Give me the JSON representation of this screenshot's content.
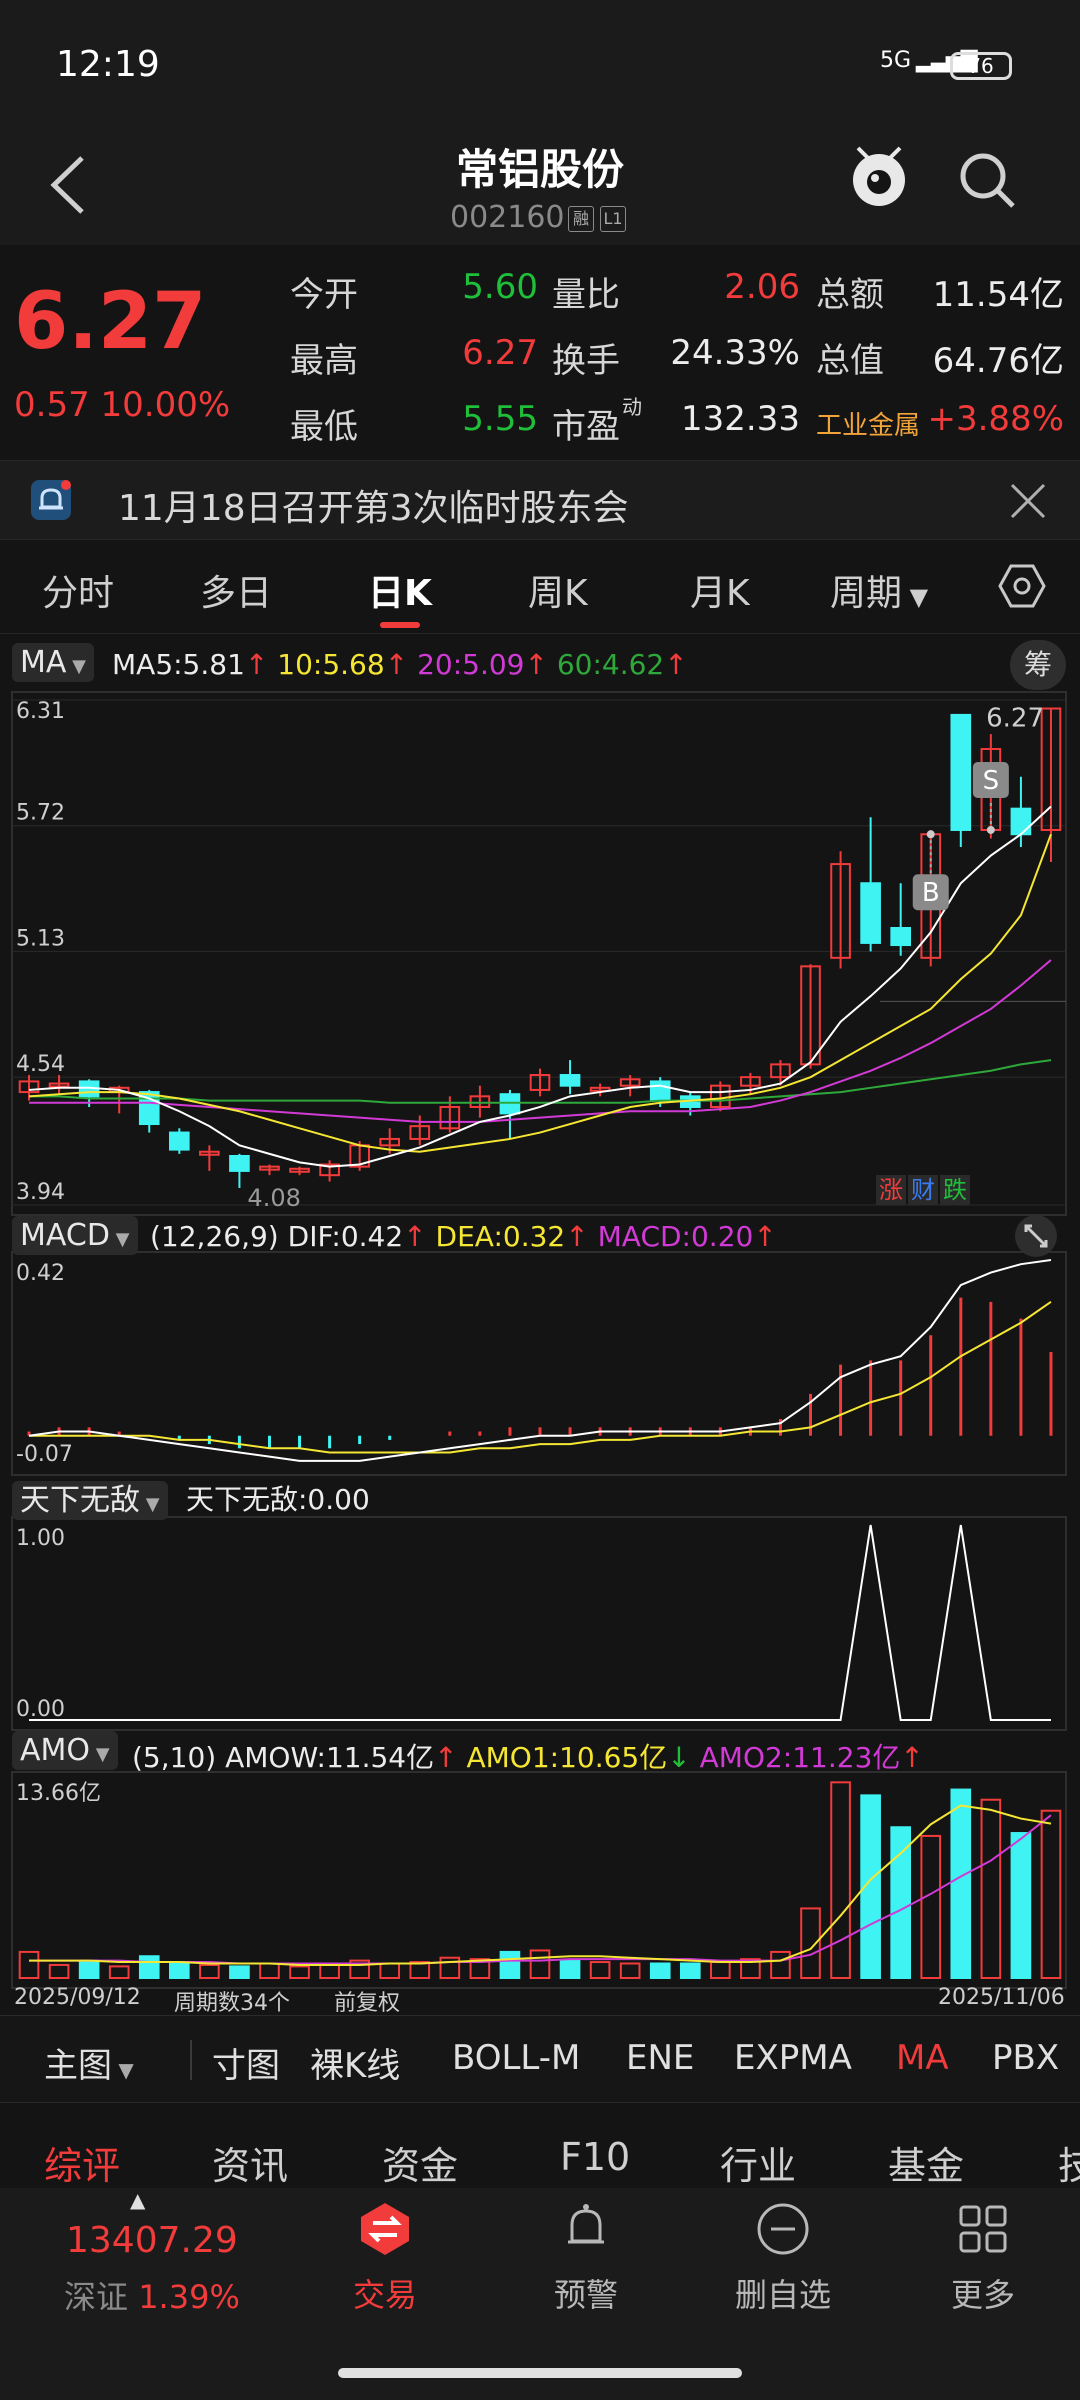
{
  "status_bar": {
    "time": "12:19",
    "signal": "5G",
    "battery": "76"
  },
  "header": {
    "title": "常铝股份",
    "code": "002160",
    "tag1": "融",
    "tag2": "L1"
  },
  "quote": {
    "price": "6.27",
    "change": "0.57",
    "change_pct": "10.00%",
    "rows": [
      {
        "l1": "今开",
        "v1": "5.60",
        "c1": "green",
        "l2": "量比",
        "v2": "2.06",
        "c2": "red",
        "l3": "总额",
        "v3": "11.54亿",
        "c3": "white"
      },
      {
        "l1": "最高",
        "v1": "6.27",
        "c1": "red",
        "l2": "换手",
        "v2": "24.33%",
        "c2": "white",
        "l3": "总值",
        "v3": "64.76亿",
        "c3": "white"
      },
      {
        "l1": "最低",
        "v1": "5.55",
        "c1": "green",
        "l2": "市盈",
        "v2": "132.33",
        "c2": "white",
        "l3": "工业金属",
        "v3": "+3.88%",
        "c3": "red"
      }
    ],
    "pe_sup": "动"
  },
  "notice": {
    "text": "11月18日召开第3次临时股东会"
  },
  "tabs": [
    "分时",
    "多日",
    "日K",
    "周K",
    "月K",
    "周期"
  ],
  "main_chart": {
    "indicator": "MA",
    "ma5": "MA5:5.81",
    "ma10": "10:5.68",
    "ma20": "20:5.09",
    "ma60": "60:4.62",
    "chip_btn": "筹",
    "y_ticks": [
      "6.31",
      "5.72",
      "5.13",
      "4.54",
      "3.94"
    ],
    "high_label": "6.27",
    "low_label": "4.08",
    "b_marker": "B",
    "s_marker": "S",
    "zdf": [
      "涨",
      "财",
      "跌"
    ]
  },
  "macd": {
    "name": "MACD",
    "params": "(12,26,9)",
    "dif": "DIF:0.42",
    "dea": "DEA:0.32",
    "macd": "MACD:0.20",
    "top": "0.42",
    "bottom": "-0.07"
  },
  "txwd": {
    "name": "天下无敌",
    "value": "天下无敌:0.00",
    "top": "1.00",
    "bottom": "0.00"
  },
  "amo": {
    "name": "AMO",
    "params": "(5,10)",
    "amow": "AMOW:11.54亿",
    "amo1": "AMO1:10.65亿",
    "amo2": "AMO2:11.23亿",
    "top": "13.66亿",
    "date_start": "2025/09/12",
    "period": "周期数34个",
    "adjust": "前复权",
    "date_end": "2025/11/06"
  },
  "indicator_bar": [
    "主图",
    "寸图",
    "裸K线",
    "BOLL-M",
    "ENE",
    "EXPMA",
    "MA",
    "PBX"
  ],
  "sections": [
    "综评",
    "资讯",
    "资金",
    "F10",
    "行业",
    "基金",
    "技"
  ],
  "index": {
    "value": "13407.29",
    "name": "深证",
    "pct": "1.39%"
  },
  "nav": [
    "交易",
    "预警",
    "删自选",
    "更多"
  ],
  "colors": {
    "up": "#f23b3b",
    "down": "#3ff3f3",
    "ma5": "#ffffff",
    "ma10": "#f5e634",
    "ma20": "#d23ad6",
    "ma60": "#2ea83a"
  },
  "chart_data": {
    "type": "candlestick",
    "candles": [
      {
        "o": 4.47,
        "c": 4.52,
        "h": 4.55,
        "l": 4.43
      },
      {
        "o": 4.5,
        "c": 4.51,
        "h": 4.55,
        "l": 4.46
      },
      {
        "o": 4.52,
        "c": 4.45,
        "h": 4.53,
        "l": 4.4
      },
      {
        "o": 4.47,
        "c": 4.49,
        "h": 4.5,
        "l": 4.37
      },
      {
        "o": 4.47,
        "c": 4.32,
        "h": 4.48,
        "l": 4.28
      },
      {
        "o": 4.28,
        "c": 4.2,
        "h": 4.3,
        "l": 4.18
      },
      {
        "o": 4.19,
        "c": 4.19,
        "h": 4.22,
        "l": 4.1
      },
      {
        "o": 4.17,
        "c": 4.1,
        "h": 4.18,
        "l": 4.02
      },
      {
        "o": 4.11,
        "c": 4.12,
        "h": 4.13,
        "l": 4.08
      },
      {
        "o": 4.1,
        "c": 4.11,
        "h": 4.12,
        "l": 4.08
      },
      {
        "o": 4.08,
        "c": 4.13,
        "h": 4.15,
        "l": 4.05
      },
      {
        "o": 4.12,
        "c": 4.22,
        "h": 4.24,
        "l": 4.1
      },
      {
        "o": 4.22,
        "c": 4.25,
        "h": 4.3,
        "l": 4.18
      },
      {
        "o": 4.25,
        "c": 4.31,
        "h": 4.36,
        "l": 4.22
      },
      {
        "o": 4.3,
        "c": 4.4,
        "h": 4.45,
        "l": 4.28
      },
      {
        "o": 4.4,
        "c": 4.45,
        "h": 4.5,
        "l": 4.35
      },
      {
        "o": 4.46,
        "c": 4.37,
        "h": 4.48,
        "l": 4.25
      },
      {
        "o": 4.48,
        "c": 4.55,
        "h": 4.58,
        "l": 4.45
      },
      {
        "o": 4.55,
        "c": 4.5,
        "h": 4.62,
        "l": 4.46
      },
      {
        "o": 4.48,
        "c": 4.49,
        "h": 4.51,
        "l": 4.45
      },
      {
        "o": 4.5,
        "c": 4.53,
        "h": 4.55,
        "l": 4.45
      },
      {
        "o": 4.52,
        "c": 4.43,
        "h": 4.54,
        "l": 4.4
      },
      {
        "o": 4.45,
        "c": 4.4,
        "h": 4.47,
        "l": 4.36
      },
      {
        "o": 4.4,
        "c": 4.5,
        "h": 4.52,
        "l": 4.38
      },
      {
        "o": 4.5,
        "c": 4.54,
        "h": 4.56,
        "l": 4.46
      },
      {
        "o": 4.54,
        "c": 4.6,
        "h": 4.62,
        "l": 4.5
      },
      {
        "o": 4.6,
        "c": 5.06,
        "h": 5.07,
        "l": 4.58
      },
      {
        "o": 5.1,
        "c": 5.54,
        "h": 5.6,
        "l": 5.05
      },
      {
        "o": 5.45,
        "c": 5.17,
        "h": 5.76,
        "l": 5.13
      },
      {
        "o": 5.24,
        "c": 5.16,
        "h": 5.45,
        "l": 5.11
      },
      {
        "o": 5.1,
        "c": 5.68,
        "h": 5.7,
        "l": 5.06
      },
      {
        "o": 6.24,
        "c": 5.7,
        "h": 6.24,
        "l": 5.62
      },
      {
        "o": 5.7,
        "c": 6.08,
        "h": 6.15,
        "l": 5.66
      },
      {
        "o": 5.8,
        "c": 5.68,
        "h": 5.95,
        "l": 5.62
      },
      {
        "o": 5.7,
        "c": 6.27,
        "h": 6.27,
        "l": 5.55
      }
    ],
    "ma5": [
      4.48,
      4.49,
      4.49,
      4.48,
      4.44,
      4.38,
      4.31,
      4.22,
      4.18,
      4.14,
      4.12,
      4.13,
      4.17,
      4.21,
      4.27,
      4.33,
      4.36,
      4.4,
      4.45,
      4.47,
      4.49,
      4.5,
      4.47,
      4.47,
      4.48,
      4.51,
      4.61,
      4.8,
      4.92,
      5.05,
      5.22,
      5.45,
      5.58,
      5.68,
      5.81
    ],
    "ma10": [
      4.45,
      4.46,
      4.47,
      4.47,
      4.46,
      4.44,
      4.41,
      4.38,
      4.34,
      4.3,
      4.26,
      4.22,
      4.2,
      4.19,
      4.21,
      4.23,
      4.25,
      4.28,
      4.32,
      4.36,
      4.4,
      4.42,
      4.43,
      4.44,
      4.46,
      4.49,
      4.54,
      4.62,
      4.7,
      4.78,
      4.86,
      5.0,
      5.12,
      5.3,
      5.68
    ],
    "ma20": [
      4.42,
      4.42,
      4.42,
      4.42,
      4.42,
      4.41,
      4.4,
      4.39,
      4.38,
      4.37,
      4.36,
      4.35,
      4.34,
      4.33,
      4.33,
      4.33,
      4.34,
      4.35,
      4.36,
      4.37,
      4.38,
      4.38,
      4.38,
      4.39,
      4.4,
      4.43,
      4.47,
      4.52,
      4.57,
      4.63,
      4.7,
      4.78,
      4.86,
      4.97,
      5.09
    ],
    "ma60": [
      4.45,
      4.45,
      4.44,
      4.44,
      4.44,
      4.44,
      4.43,
      4.43,
      4.43,
      4.43,
      4.43,
      4.43,
      4.42,
      4.42,
      4.42,
      4.42,
      4.42,
      4.42,
      4.42,
      4.42,
      4.42,
      4.43,
      4.43,
      4.43,
      4.44,
      4.45,
      4.46,
      4.47,
      4.49,
      4.51,
      4.53,
      4.55,
      4.57,
      4.6,
      4.62
    ],
    "macd_dif": [
      0.0,
      0.01,
      0.01,
      0.0,
      -0.01,
      -0.02,
      -0.03,
      -0.04,
      -0.05,
      -0.06,
      -0.06,
      -0.06,
      -0.05,
      -0.04,
      -0.03,
      -0.02,
      -0.01,
      0.0,
      0.0,
      0.01,
      0.01,
      0.01,
      0.01,
      0.01,
      0.02,
      0.03,
      0.08,
      0.14,
      0.17,
      0.19,
      0.26,
      0.36,
      0.39,
      0.41,
      0.42
    ],
    "macd_dea": [
      0.0,
      0.0,
      0.0,
      0.0,
      0.0,
      -0.01,
      -0.01,
      -0.02,
      -0.03,
      -0.03,
      -0.04,
      -0.04,
      -0.04,
      -0.04,
      -0.04,
      -0.03,
      -0.03,
      -0.02,
      -0.02,
      -0.01,
      -0.01,
      0.0,
      0.0,
      0.0,
      0.01,
      0.01,
      0.02,
      0.05,
      0.08,
      0.1,
      0.14,
      0.19,
      0.23,
      0.27,
      0.32
    ],
    "macd_hist": [
      0.01,
      0.02,
      0.02,
      0.01,
      0.0,
      -0.01,
      -0.02,
      -0.03,
      -0.03,
      -0.03,
      -0.03,
      -0.02,
      -0.01,
      0.0,
      0.01,
      0.01,
      0.02,
      0.02,
      0.02,
      0.02,
      0.02,
      0.02,
      0.02,
      0.02,
      0.02,
      0.04,
      0.1,
      0.17,
      0.18,
      0.18,
      0.24,
      0.33,
      0.32,
      0.28,
      0.2
    ],
    "txwd": [
      0,
      0,
      0,
      0,
      0,
      0,
      0,
      0,
      0,
      0,
      0,
      0,
      0,
      0,
      0,
      0,
      0,
      0,
      0,
      0,
      0,
      0,
      0,
      0,
      0,
      0,
      0,
      0,
      1,
      0,
      0,
      1,
      0,
      0,
      0,
      0
    ],
    "amo": [
      1.8,
      0.9,
      1.2,
      0.8,
      1.5,
      1.0,
      0.9,
      0.8,
      1.0,
      0.8,
      0.9,
      1.2,
      1.0,
      1.1,
      1.4,
      1.3,
      1.8,
      1.9,
      1.2,
      1.1,
      1.0,
      1.0,
      1.0,
      1.1,
      1.3,
      1.8,
      4.8,
      13.5,
      12.6,
      10.4,
      9.8,
      13.0,
      12.3,
      10.0,
      11.54
    ],
    "amo1": [
      1.2,
      1.2,
      1.2,
      1.1,
      1.1,
      1.1,
      1.0,
      1.0,
      1.0,
      0.9,
      0.9,
      0.9,
      1.0,
      1.0,
      1.1,
      1.2,
      1.3,
      1.4,
      1.5,
      1.5,
      1.4,
      1.3,
      1.2,
      1.1,
      1.1,
      1.2,
      2.0,
      4.3,
      6.8,
      8.6,
      10.6,
      11.9,
      11.6,
      11.0,
      10.65
    ],
    "amo2": [
      1.2,
      1.2,
      1.2,
      1.2,
      1.1,
      1.1,
      1.1,
      1.0,
      1.0,
      1.0,
      1.0,
      1.0,
      1.0,
      1.0,
      1.1,
      1.1,
      1.2,
      1.2,
      1.3,
      1.3,
      1.3,
      1.3,
      1.3,
      1.2,
      1.2,
      1.2,
      1.6,
      2.6,
      3.7,
      4.7,
      5.8,
      7.0,
      8.1,
      9.6,
      11.23
    ]
  }
}
